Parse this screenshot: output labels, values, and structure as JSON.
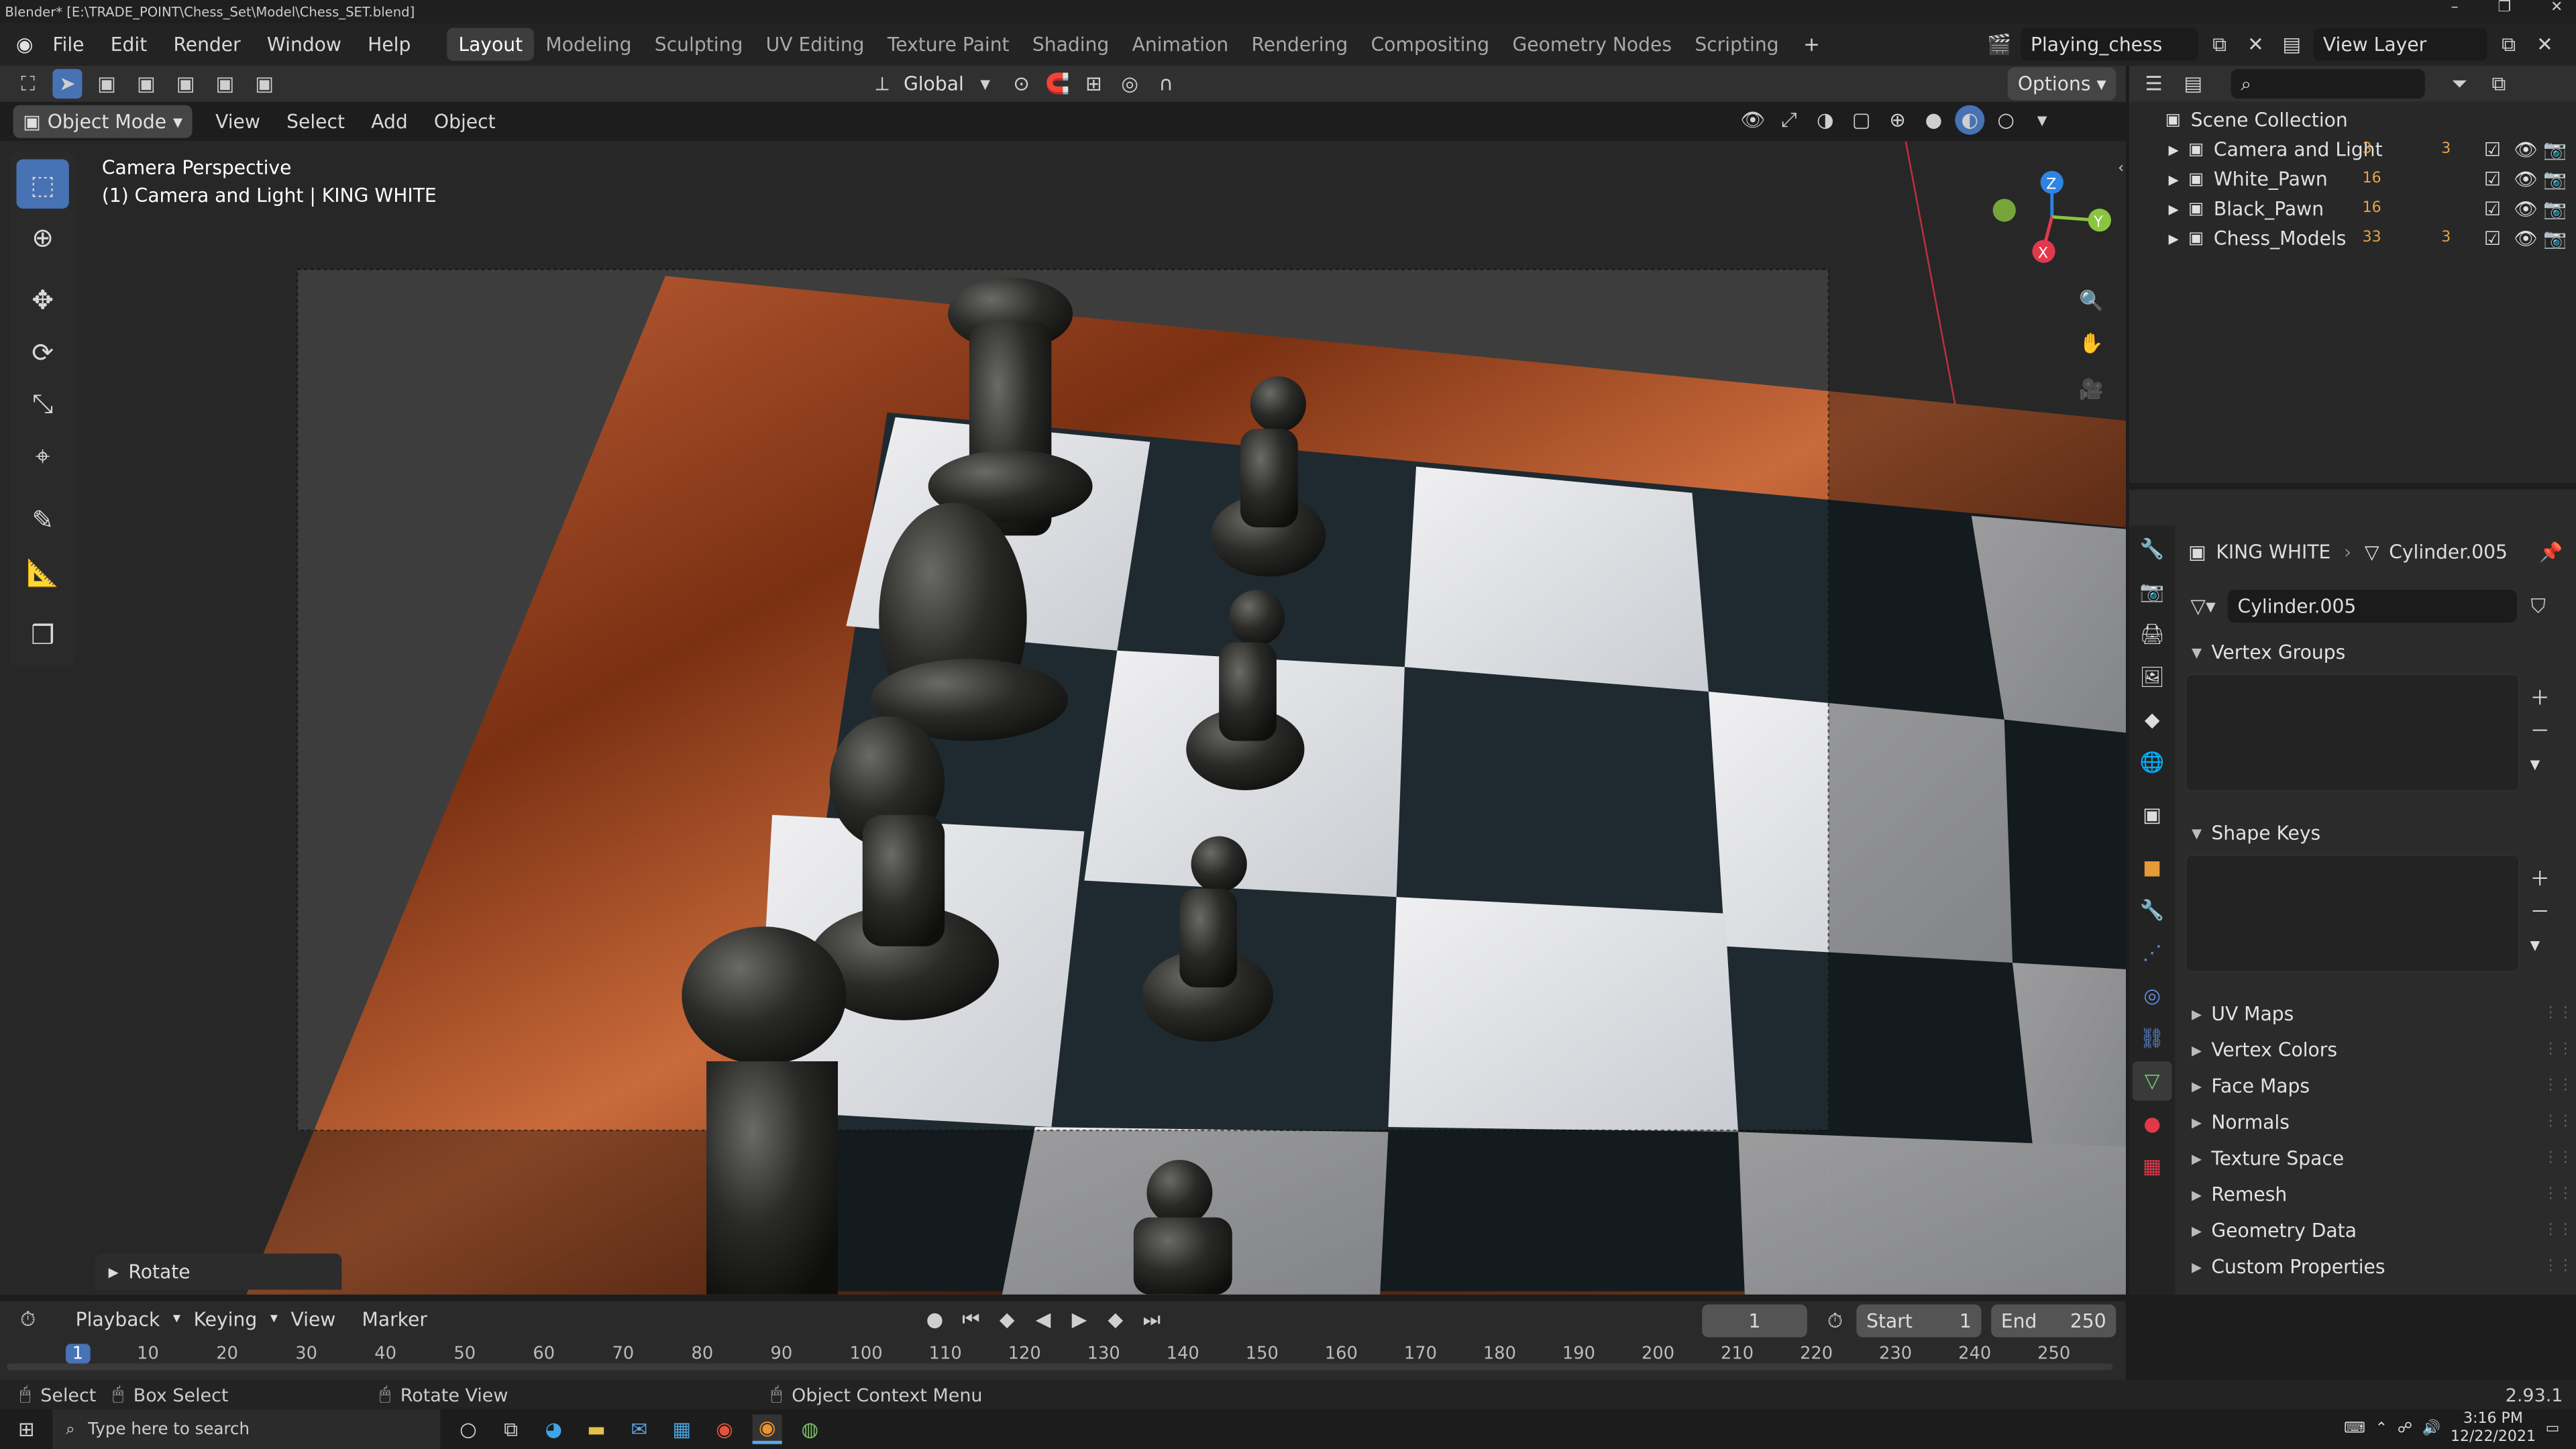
{
  "window": {
    "title": "Blender* [E:\\TRADE_POINT\\Chess_Set\\Model\\Chess_SET.blend]"
  },
  "menu": [
    "File",
    "Edit",
    "Render",
    "Window",
    "Help"
  ],
  "workspaces": [
    "Layout",
    "Modeling",
    "Sculpting",
    "UV Editing",
    "Texture Paint",
    "Shading",
    "Animation",
    "Rendering",
    "Compositing",
    "Geometry Nodes",
    "Scripting"
  ],
  "active_workspace": "Layout",
  "scene_name": "Playing_chess",
  "view_layer": "View Layer",
  "viewport": {
    "mode": "Object Mode",
    "menus": [
      "View",
      "Select",
      "Add",
      "Object"
    ],
    "transform_orientation": "Global",
    "options_label": "Options",
    "info_line1": "Camera Perspective",
    "info_line2": "(1) Camera and Light | KING WHITE",
    "last_operator": "Rotate"
  },
  "outliner": {
    "root": "Scene Collection",
    "items": [
      {
        "name": "Camera and Light",
        "badge": "3"
      },
      {
        "name": "White_Pawn",
        "badge": "16"
      },
      {
        "name": "Black_Pawn",
        "badge": "16"
      },
      {
        "name": "Chess_Models",
        "badge": "33"
      }
    ],
    "extra_badge": "3"
  },
  "properties": {
    "object_name": "KING WHITE",
    "mesh_name": "Cylinder.005",
    "datablock": "Cylinder.005",
    "panels_open": [
      "Vertex Groups",
      "Shape Keys"
    ],
    "panels_closed": [
      "UV Maps",
      "Vertex Colors",
      "Face Maps",
      "Normals",
      "Texture Space",
      "Remesh",
      "Geometry Data",
      "Custom Properties"
    ]
  },
  "timeline": {
    "menus": [
      "Playback",
      "Keying",
      "View",
      "Marker"
    ],
    "current_frame": "1",
    "start_label": "Start",
    "start": "1",
    "end_label": "End",
    "end": "250",
    "ticks": [
      "1",
      "10",
      "20",
      "30",
      "40",
      "50",
      "60",
      "70",
      "80",
      "90",
      "100",
      "110",
      "120",
      "130",
      "140",
      "150",
      "160",
      "170",
      "180",
      "190",
      "200",
      "210",
      "220",
      "230",
      "240",
      "250"
    ]
  },
  "statusbar": {
    "select": "Select",
    "box_select": "Box Select",
    "rotate_view": "Rotate View",
    "context_menu": "Object Context Menu",
    "version": "2.93.1"
  },
  "taskbar": {
    "search_placeholder": "Type here to search",
    "time": "3:16 PM",
    "date": "12/22/2021"
  },
  "colors": {
    "accent": "#4772b3",
    "axis_x": "#e2384c",
    "axis_y": "#8bc53f",
    "axis_z": "#2f83e3"
  }
}
